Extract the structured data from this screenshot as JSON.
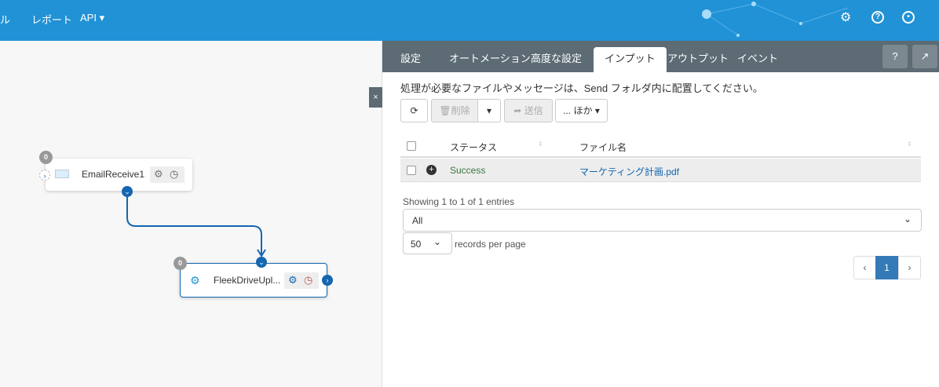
{
  "topbar": {
    "nav": [
      "ル",
      "レポート",
      "API"
    ],
    "icons": [
      "gear-icon",
      "help-icon",
      "user-icon"
    ]
  },
  "canvas": {
    "nodes": [
      {
        "title": "EmailReceive1",
        "badge": "0"
      },
      {
        "title": "FleekDriveUpl...",
        "badge": "0"
      }
    ],
    "close": "×"
  },
  "panel": {
    "tabs": [
      "設定",
      "オートメーション",
      "高度な設定",
      "インプット",
      "アウトプット",
      "イベント"
    ],
    "active_tab": "インプット",
    "message": "処理が必要なファイルやメッセージは、Send フォルダ内に配置してください。",
    "toolbar": {
      "delete": "削除",
      "send": "送信",
      "more": "... ほか"
    },
    "table": {
      "columns": [
        "ステータス",
        "ファイル名"
      ],
      "rows": [
        {
          "status": "Success",
          "file": "マーケティング計画.pdf"
        }
      ]
    },
    "info": "Showing 1 to 1 of 1 entries",
    "filter": "All",
    "page_size": "50",
    "page_size_label": "records per page",
    "page": "1",
    "colors": {
      "accent": "#2192d6",
      "success": "#3c763d",
      "link": "#1466b0"
    }
  }
}
